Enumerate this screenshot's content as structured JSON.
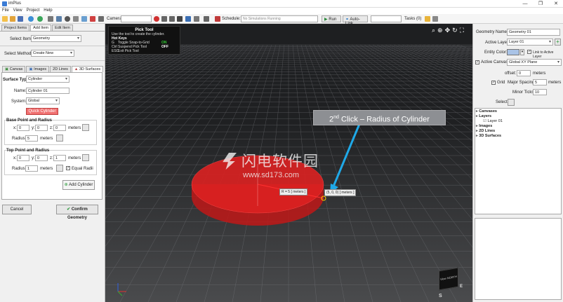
{
  "window": {
    "title": "imPlus",
    "controls": [
      "—",
      "❐",
      "✕"
    ]
  },
  "menu": [
    "File",
    "View",
    "Project",
    "Help"
  ],
  "toolbar": {
    "camera_label": "Camera:",
    "schedule_label": "Schedule:",
    "schedule_placeholder": "No Simulations Running",
    "run_label": "Run",
    "autolink_label": "Auto-Link",
    "tasks_label": "Tasks (0)"
  },
  "left_panel": {
    "top_tabs": [
      "Project Items",
      "Add Item",
      "Edit Item"
    ],
    "select_item_label": "Select Item:",
    "select_item_value": "Geometry",
    "select_method_label": "Select Method:",
    "select_method_value": "Create New",
    "sub_tabs": [
      "Canvas",
      "Images",
      "2D Lines",
      "3D Surfaces"
    ],
    "surface_type_label": "Surface Type:",
    "surface_type_value": "Cylinder",
    "name_label": "Name:",
    "name_value": "Cylinder 01",
    "system_label": "System:",
    "system_value": "Global",
    "quick_button": "Quick Cylinder",
    "base": {
      "title": "Base Point and Radius",
      "x": "0",
      "y": "0",
      "z": "0",
      "units": "meters",
      "radius_label": "Radius:",
      "radius": "5",
      "radius_units": "meters"
    },
    "top": {
      "title": "Top Point and Radius",
      "x": "0",
      "y": "0",
      "z": "1",
      "units": "meters",
      "radius_label": "Radius:",
      "radius": "1",
      "radius_units": "meters",
      "equal_radii": "Equal Radii"
    },
    "add_button": "Add Cylinder",
    "cancel_button": "Cancel",
    "confirm_button": "Confirm Geometry"
  },
  "viewport": {
    "pick_tool": {
      "title": "Pick Tool",
      "instruction": "Use the tool to create the cylinder.",
      "hot_keys_title": "Hot Keys",
      "keys": [
        {
          "key": "G",
          "action": "Toggle Snap-to-Grid",
          "state": "ON"
        },
        {
          "key": "Ctrl",
          "action": "Suspend Pick Tool",
          "state": "OFF"
        },
        {
          "key": "ESC",
          "action": "Exit Pick Tool",
          "state": ""
        }
      ]
    },
    "annotation_main": "2",
    "annotation_sup": "nd",
    "annotation_rest": " Click – Radius of Cylinder",
    "radius_label": "R = 5 [ meters ]",
    "point_label": "(5, 0, 0) [ meters ]",
    "watermark_cn": "闪电软件园",
    "watermark_url": "www.sd173.com",
    "viewcube": {
      "face": "View NORTH",
      "e": "E",
      "s": "S"
    },
    "accent_color": "#1fa9e8",
    "cylinder_color": "#d92020"
  },
  "right_panel": {
    "geometry_name_label": "Geometry Name:",
    "geometry_name": "Geometry 01",
    "active_layer_label": "Active Layer:",
    "active_layer": "Layer 01",
    "entity_color_label": "Entity Color:",
    "link_label": "Link to Active Layer",
    "active_canvas_label": "Active Canvas:",
    "active_canvas": "Global XY Plane",
    "offset_label": "offset:",
    "offset_value": "0",
    "offset_units": "meters",
    "grid_label": "Grid",
    "major_spacing_label": "Major Spacing:",
    "major_spacing": "5",
    "major_units": "meters",
    "minor_ticks_label": "Minor Ticks:",
    "minor_ticks": "10",
    "select_label": "Select:",
    "tree": [
      {
        "label": "Canvases",
        "indent": 0,
        "bold": true
      },
      {
        "label": "Layers",
        "indent": 0,
        "bold": true
      },
      {
        "label": "Layer 01",
        "indent": 1,
        "bold": false
      },
      {
        "label": "Images",
        "indent": 0,
        "bold": true
      },
      {
        "label": "2D Lines",
        "indent": 0,
        "bold": true
      },
      {
        "label": "3D Surfaces",
        "indent": 0,
        "bold": true
      }
    ]
  }
}
